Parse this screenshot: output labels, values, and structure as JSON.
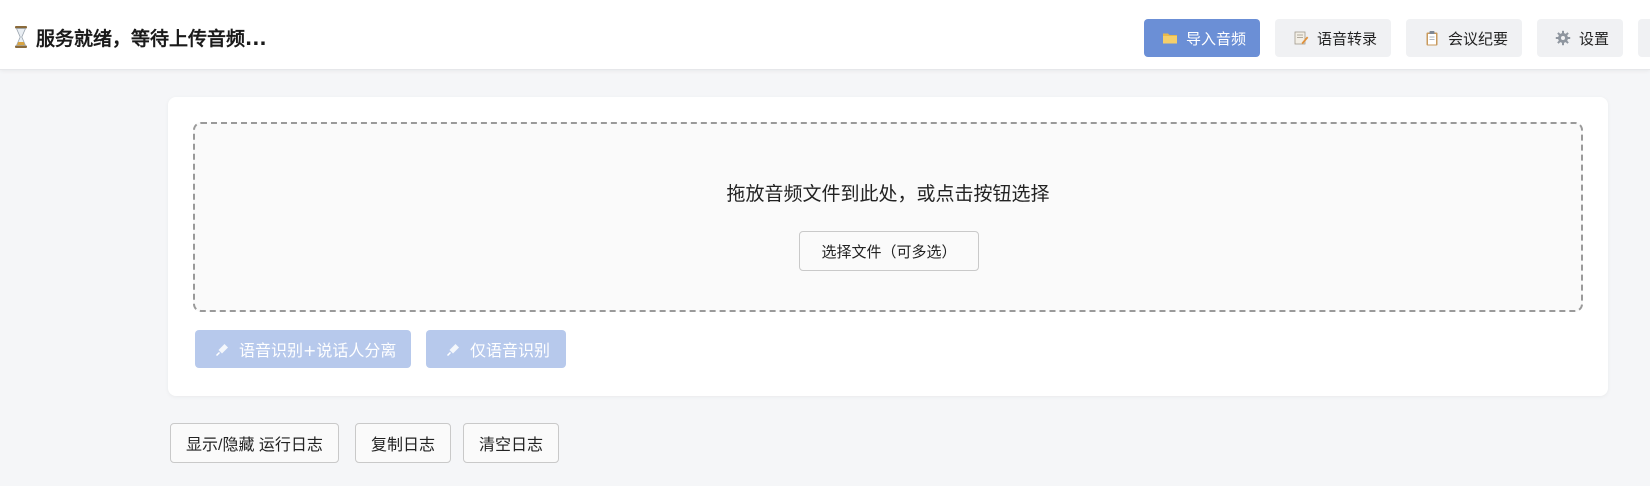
{
  "status": {
    "icon": "hourglass-icon",
    "text": "服务就绪，等待上传音频..."
  },
  "nav": [
    {
      "label": "导入音频",
      "icon": "folder-icon",
      "active": true
    },
    {
      "label": "语音转录",
      "icon": "memo-icon",
      "active": false
    },
    {
      "label": "会议纪要",
      "icon": "clipboard-icon",
      "active": false
    },
    {
      "label": "设置",
      "icon": "gear-icon",
      "active": false
    }
  ],
  "upload": {
    "drop_text": "拖放音频文件到此处，或点击按钮选择",
    "choose_button": "选择文件（可多选）"
  },
  "actions": {
    "asr_diarize": "语音识别+说话人分离",
    "asr_only": "仅语音识别",
    "icon": "microphone-icon",
    "disabled": true
  },
  "log_buttons": {
    "toggle": "显示/隐藏 运行日志",
    "copy": "复制日志",
    "clear": "清空日志"
  },
  "colors": {
    "accent": "#6b8fd6",
    "accent_disabled": "#b7c9ec",
    "background": "#f5f6f8"
  }
}
